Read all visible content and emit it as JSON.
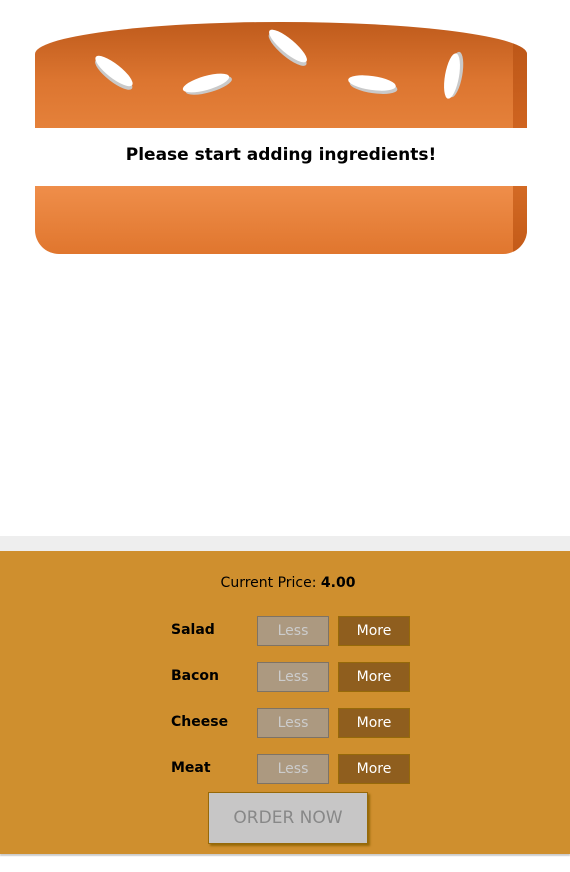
{
  "burger": {
    "message": "Please start adding ingredients!"
  },
  "controls": {
    "price_label": "Current Price:",
    "price_value": "4.00",
    "items": [
      {
        "label": "Salad",
        "less": "Less",
        "more": "More"
      },
      {
        "label": "Bacon",
        "less": "Less",
        "more": "More"
      },
      {
        "label": "Cheese",
        "less": "Less",
        "more": "More"
      },
      {
        "label": "Meat",
        "less": "Less",
        "more": "More"
      }
    ],
    "order_button": "ORDER NOW"
  },
  "colors": {
    "bun_top": "#d46f2a",
    "bun_bottom": "#e8843f",
    "controls_background": "#cf8f2e",
    "more_button": "#8f5e1e",
    "less_button_disabled": "#ac9980",
    "order_button_disabled": "#c7c6c6"
  },
  "icons": {
    "seeds": "sesame-seed-icon"
  }
}
